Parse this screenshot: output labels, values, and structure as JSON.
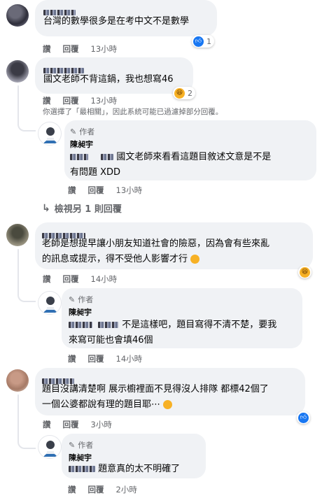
{
  "comments": [
    {
      "text": "台灣的數學很多是在考中文不是數學",
      "actions": {
        "reply_a": "讚",
        "reply_b": "回覆",
        "time": "13小時"
      },
      "reaction": {
        "icon": "like-icon",
        "count": "1"
      }
    },
    {
      "text": "國文老師不背這鍋，我也想寫46",
      "actions": {
        "reply_a": "讚",
        "reply_b": "回覆",
        "time": "13小時"
      },
      "reaction": {
        "icon": "haha-icon",
        "count": "2"
      },
      "notice": "你選擇了「最相關」，因此系統可能已過濾掉部分回覆。",
      "reply": {
        "author_tag": "作者",
        "author_name": "陳昶宇",
        "text_line1": "國文老師來看看這題目敘述文意是不是",
        "text_line2": "有問題 XDD",
        "actions": {
          "reply_a": "讚",
          "reply_b": "回覆",
          "time": "13小時"
        }
      },
      "more_replies": "檢視另 1 則回覆"
    },
    {
      "text_line1": "老師是想提早讓小朋友知道社會的險惡，因為會有些來亂",
      "text_line2": "的訊息或提示，得不受他人影響才行",
      "actions": {
        "reply_a": "讚",
        "reply_b": "回覆",
        "time": "14小時"
      },
      "reaction": {
        "icon": "haha-icon",
        "count": ""
      },
      "reply": {
        "author_tag": "作者",
        "author_name": "陳昶宇",
        "text_line1": "不是這樣吧，題目寫得不清不楚，要我",
        "text_line2": "來寫可能也會填46個",
        "actions": {
          "reply_a": "讚",
          "reply_b": "回覆",
          "time": "14小時"
        }
      }
    },
    {
      "text_line1": "題目沒講清楚啊 展示櫥裡面不見得沒人排隊 都標42個了",
      "text_line2": "一個公婆都說有理的題目耶⋯",
      "actions": {
        "reply_a": "讚",
        "reply_b": "回覆",
        "time": "3小時"
      },
      "reaction": {
        "icon": "like-icon",
        "count": ""
      },
      "reply": {
        "author_tag": "作者",
        "author_name": "陳昶宇",
        "text_line1": "題意真的太不明確了",
        "actions": {
          "reply_a": "讚",
          "reply_b": "回覆",
          "time": "2小時"
        }
      }
    }
  ]
}
